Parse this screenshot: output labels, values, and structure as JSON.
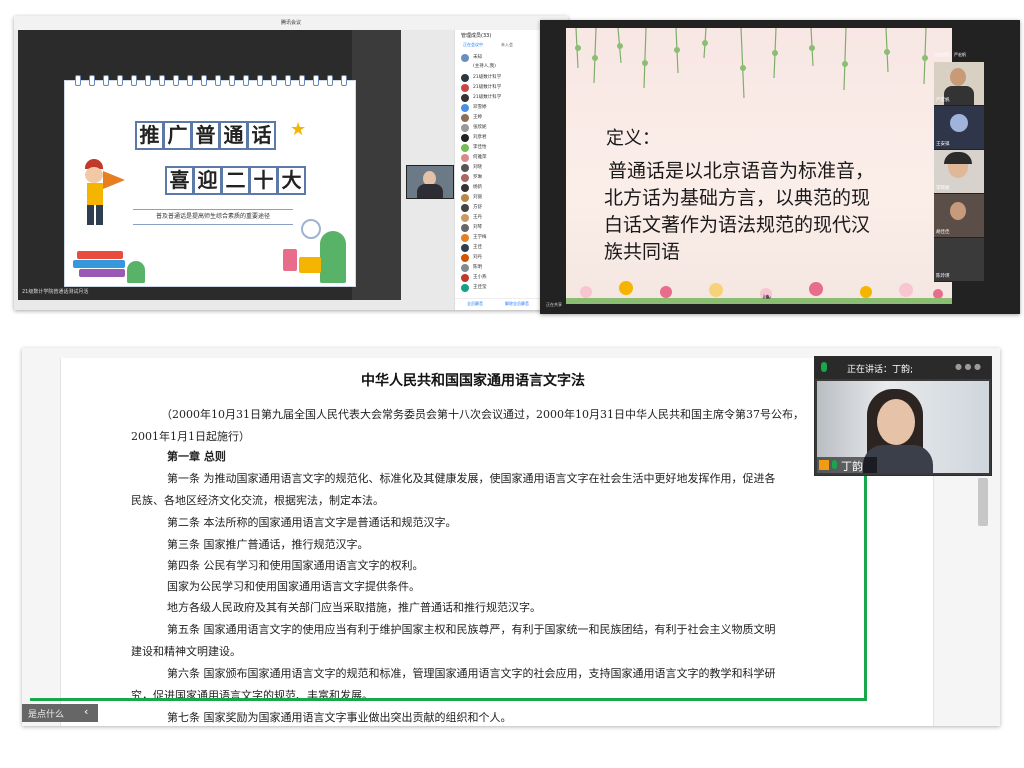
{
  "shot1": {
    "window_title": "腾讯会议",
    "slide": {
      "title_line1": [
        "推",
        "广",
        "普",
        "通",
        "话"
      ],
      "title_line2": [
        "喜",
        "迎",
        "二",
        "十",
        "大"
      ],
      "subtitle": "普及普通话是提高师生综合素质的重要途径"
    },
    "participant_list_title": "管理成员(33)",
    "participant_tabs": [
      "正在会议中",
      "未入会"
    ],
    "participants": [
      "未知",
      "(主持人,我)",
      "21级数计科学",
      "21级数计科学",
      "21级数计科学",
      "邓雪婷",
      "王婷",
      "张欣妮",
      "刘彦君",
      "李佳怡",
      "何雅萍",
      "刘晓",
      "罗琳",
      "杨新",
      "刘丽",
      "方舒",
      "王丹",
      "刘琴",
      "王学梅",
      "王佳",
      "刘丹",
      "陈明",
      "王小燕",
      "王佳莹"
    ],
    "footer_buttons": [
      "全员静音",
      "解除全员静音",
      "更多"
    ],
    "bottom_caption": "21级数计学院普通话测试月活"
  },
  "shot2": {
    "definition_label": "定义：",
    "definition_lines": [
      "普通话是以北京语音为标准音，",
      "北方话为基础方言，以典范的现",
      "白话文著作为语法规范的现代汉",
      "族共同语"
    ],
    "speaking": "正在讲话：严宏帆",
    "tiles": [
      "严宏帆",
      "王安祺",
      "李晓丽",
      "胡佳佳",
      "陈玲瑛"
    ],
    "bottom_left": "正在共享"
  },
  "shot3": {
    "doc_title": "中华人民共和国国家通用语言文字法",
    "lines": [
      "（2000年10月31日第九届全国人民代表大会常务委员会第十八次会议通过，2000年10月31日中华人民共和国主席令第37号公布，",
      "2001年1月1日起施行）",
      "第一章   总则",
      "第一条   为推动国家通用语言文字的规范化、标准化及其健康发展，使国家通用语言文字在社会生活中更好地发挥作用，促进各",
      "民族、各地区经济文化交流，根据宪法，制定本法。",
      "第二条   本法所称的国家通用语言文字是普通话和规范汉字。",
      "第三条   国家推广普通话，推行规范汉字。",
      "第四条   公民有学习和使用国家通用语言文字的权利。",
      "国家为公民学习和使用国家通用语言文字提供条件。",
      "地方各级人民政府及其有关部门应当采取措施，推广普通话和推行规范汉字。",
      "第五条   国家通用语言文字的使用应当有利于维护国家主权和民族尊严，有利于国家统一和民族团结，有利于社会主义物质文明",
      "建设和精神文明建设。",
      "第六条   国家颁布国家通用语言文字的规范和标准，管理国家通用语言文字的社会应用，支持国家通用语言文字的教学和科学研",
      "究，促进国家通用语言文字的规范、丰富和发展。",
      "第七条   国家奖励为国家通用语言文字事业做出突出贡献的组织和个人。"
    ],
    "speaking_label": "正在讲话：丁韵;",
    "speaker_name": "丁韵",
    "bottom_left_label": "是点什么",
    "accent_green": "#1aa64a"
  }
}
